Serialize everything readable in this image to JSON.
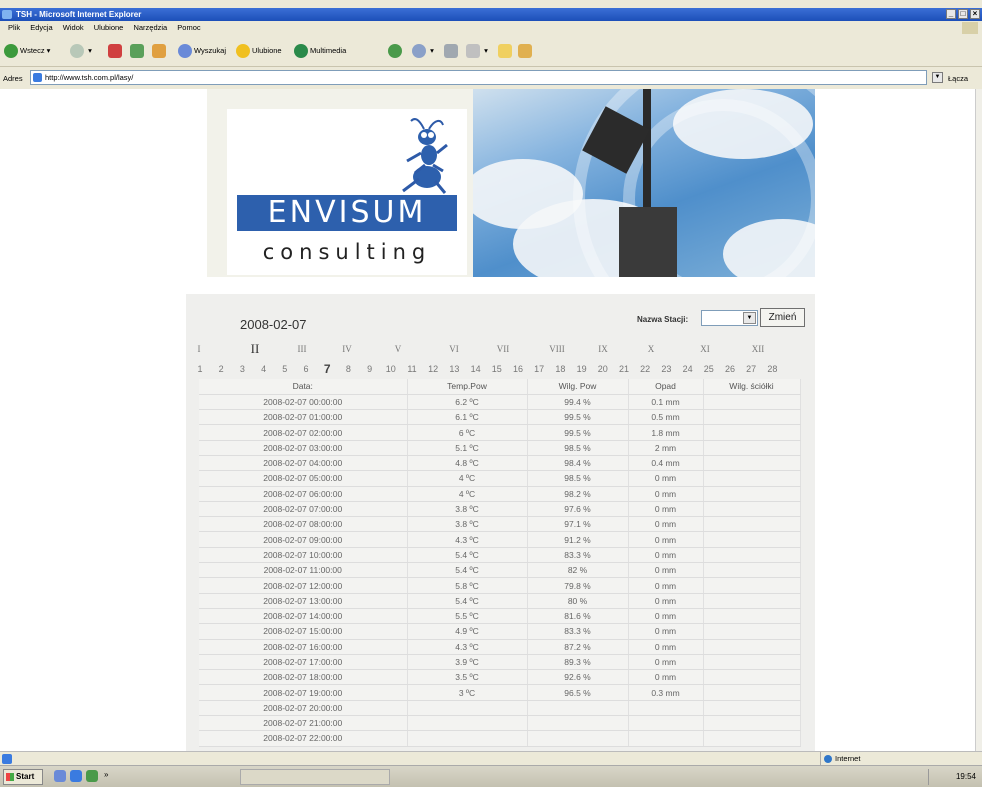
{
  "window": {
    "title": "TSH - Microsoft Internet Explorer"
  },
  "menu": [
    "Plik",
    "Edycja",
    "Widok",
    "Ulubione",
    "Narzędzia",
    "Pomoc"
  ],
  "toolbar": {
    "back": "Wstecz",
    "search": "Wyszukaj",
    "favorites": "Ulubione",
    "media": "Multimedia"
  },
  "address": {
    "label": "Adres",
    "url": "http://www.tsh.com.pl/lasy/",
    "links": "Łącza"
  },
  "banner": {
    "brand": "ENVISUM",
    "sub": "consulting"
  },
  "panel": {
    "date": "2008-02-07",
    "station_label": "Nazwa Stacji:",
    "station_value": "",
    "change_button": "Zmień",
    "months": [
      "I",
      "II",
      "III",
      "IV",
      "V",
      "VI",
      "VII",
      "VIII",
      "IX",
      "X",
      "XI",
      "XII"
    ],
    "selected_month": "II",
    "days": [
      "1",
      "2",
      "3",
      "4",
      "5",
      "6",
      "7",
      "8",
      "9",
      "10",
      "11",
      "12",
      "13",
      "14",
      "15",
      "16",
      "17",
      "18",
      "19",
      "20",
      "21",
      "22",
      "23",
      "24",
      "25",
      "26",
      "27",
      "28"
    ],
    "selected_day": "7"
  },
  "table": {
    "headers": [
      "Data:",
      "Temp.Pow",
      "Wilg. Pow",
      "Opad",
      "Wilg. ściółki"
    ],
    "rows": [
      [
        "2008-02-07 00:00:00",
        "6.2 ºC",
        "99.4 %",
        "0.1 mm",
        ""
      ],
      [
        "2008-02-07 01:00:00",
        "6.1 ºC",
        "99.5 %",
        "0.5 mm",
        ""
      ],
      [
        "2008-02-07 02:00:00",
        "6 ºC",
        "99.5 %",
        "1.8 mm",
        ""
      ],
      [
        "2008-02-07 03:00:00",
        "5.1 ºC",
        "98.5 %",
        "2 mm",
        ""
      ],
      [
        "2008-02-07 04:00:00",
        "4.8 ºC",
        "98.4 %",
        "0.4 mm",
        ""
      ],
      [
        "2008-02-07 05:00:00",
        "4 ºC",
        "98.5 %",
        "0 mm",
        ""
      ],
      [
        "2008-02-07 06:00:00",
        "4 ºC",
        "98.2 %",
        "0 mm",
        ""
      ],
      [
        "2008-02-07 07:00:00",
        "3.8 ºC",
        "97.6 %",
        "0 mm",
        ""
      ],
      [
        "2008-02-07 08:00:00",
        "3.8 ºC",
        "97.1 %",
        "0 mm",
        ""
      ],
      [
        "2008-02-07 09:00:00",
        "4.3 ºC",
        "91.2 %",
        "0 mm",
        ""
      ],
      [
        "2008-02-07 10:00:00",
        "5.4 ºC",
        "83.3 %",
        "0 mm",
        ""
      ],
      [
        "2008-02-07 11:00:00",
        "5.4 ºC",
        "82 %",
        "0 mm",
        ""
      ],
      [
        "2008-02-07 12:00:00",
        "5.8 ºC",
        "79.8 %",
        "0 mm",
        ""
      ],
      [
        "2008-02-07 13:00:00",
        "5.4 ºC",
        "80 %",
        "0 mm",
        ""
      ],
      [
        "2008-02-07 14:00:00",
        "5.5 ºC",
        "81.6 %",
        "0 mm",
        ""
      ],
      [
        "2008-02-07 15:00:00",
        "4.9 ºC",
        "83.3 %",
        "0 mm",
        ""
      ],
      [
        "2008-02-07 16:00:00",
        "4.3 ºC",
        "87.2 %",
        "0 mm",
        ""
      ],
      [
        "2008-02-07 17:00:00",
        "3.9 ºC",
        "89.3 %",
        "0 mm",
        ""
      ],
      [
        "2008-02-07 18:00:00",
        "3.5 ºC",
        "92.6 %",
        "0 mm",
        ""
      ],
      [
        "2008-02-07 19:00:00",
        "3 ºC",
        "96.5 %",
        "0.3 mm",
        ""
      ],
      [
        "2008-02-07 20:00:00",
        "",
        "",
        "",
        ""
      ],
      [
        "2008-02-07 21:00:00",
        "",
        "",
        "",
        ""
      ],
      [
        "2008-02-07 22:00:00",
        "",
        "",
        "",
        ""
      ]
    ]
  },
  "status": {
    "zone": "Internet"
  },
  "taskbar": {
    "start": "Start",
    "clock": "19:54"
  }
}
